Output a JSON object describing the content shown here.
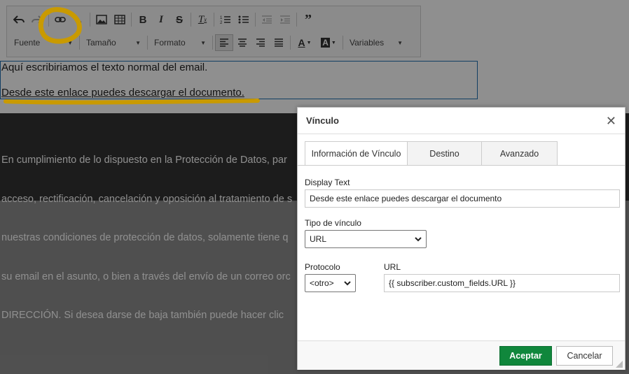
{
  "toolbar": {
    "row1_icons": [
      "undo-icon",
      "redo-icon",
      "link-icon",
      "unlink-icon",
      "image-icon",
      "table-icon",
      "bold-icon",
      "italic-icon",
      "strikethrough-icon",
      "clear-format-icon",
      "numbered-list-icon",
      "bulleted-list-icon",
      "outdent-icon",
      "indent-icon",
      "blockquote-icon"
    ],
    "font_label": "Fuente",
    "size_label": "Tamaño",
    "format_label": "Formato",
    "variables_label": "Variables"
  },
  "editor": {
    "line1": "Aquí escribiriamos el texto normal del email.",
    "line2": "Desde este enlace puedes descargar el documento."
  },
  "footer": {
    "lines": [
      "En cumplimiento de lo dispuesto en la Protección de Datos, par",
      "acceso, rectificación, cancelación y oposición al tratamiento de s",
      "nuestras condiciones de protección de datos, solamente tiene q",
      "su email en el asunto, o bien a través del envío de un correo orc",
      "DIRECCIÓN. Si desea darse de baja también puede hacer clic"
    ]
  },
  "dialog": {
    "title": "Vínculo",
    "close_glyph": "✕",
    "tabs": [
      "Información de Vínculo",
      "Destino",
      "Avanzado"
    ],
    "display_text_label": "Display Text",
    "display_text_value": "Desde este enlace puedes descargar el documento",
    "link_type_label": "Tipo de vínculo",
    "link_type_value": "URL",
    "protocol_label": "Protocolo",
    "protocol_value": "<otro>",
    "url_label": "URL",
    "url_value": "{{ subscriber.custom_fields.URL }}",
    "ok_label": "Aceptar",
    "cancel_label": "Cancelar"
  },
  "colors": {
    "accept_green": "#10873c",
    "annotation_orange": "#ff6a00",
    "annotation_gold": "#c99a00",
    "editor_border": "#1f6fb0"
  }
}
